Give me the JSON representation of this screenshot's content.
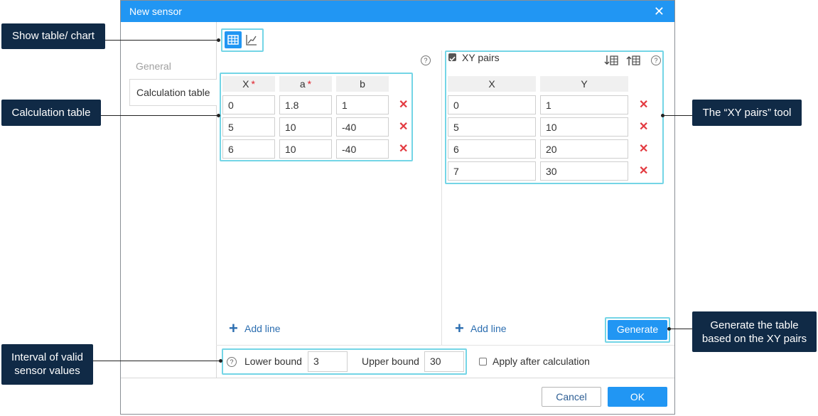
{
  "dialog": {
    "title": "New sensor",
    "tabs": [
      "General",
      "Calculation table"
    ]
  },
  "toolbar": {
    "table_icon": "table-icon",
    "chart_icon": "chart-icon"
  },
  "calc_table": {
    "headers": [
      "X",
      "a",
      "b"
    ],
    "required_marker": "*",
    "rows": [
      [
        "0",
        "1.8",
        "1"
      ],
      [
        "5",
        "10",
        "-40"
      ],
      [
        "6",
        "10",
        "-40"
      ]
    ],
    "add_line": "Add line"
  },
  "xy": {
    "label": "XY pairs",
    "checked": true,
    "headers": [
      "X",
      "Y"
    ],
    "rows": [
      [
        "0",
        "1"
      ],
      [
        "5",
        "10"
      ],
      [
        "6",
        "20"
      ],
      [
        "7",
        "30"
      ]
    ],
    "add_line": "Add line",
    "generate": "Generate"
  },
  "bounds": {
    "lower_label": "Lower bound",
    "lower_value": "3",
    "upper_label": "Upper bound",
    "upper_value": "30",
    "apply_label": "Apply after calculation"
  },
  "footer": {
    "cancel": "Cancel",
    "ok": "OK"
  },
  "callouts": {
    "show_table_chart": "Show table/ chart",
    "calc_table": "Calculation table",
    "xy_tool": "The “XY pairs” tool",
    "generate_line1": "Generate the table",
    "generate_line2": "based on the XY pairs",
    "interval_line1": "Interval of valid",
    "interval_line2": "sensor values"
  },
  "colors": {
    "accent": "#2196f3",
    "highlight": "#74d5e6",
    "callout_bg": "#102a46",
    "delete": "#e3393f"
  }
}
